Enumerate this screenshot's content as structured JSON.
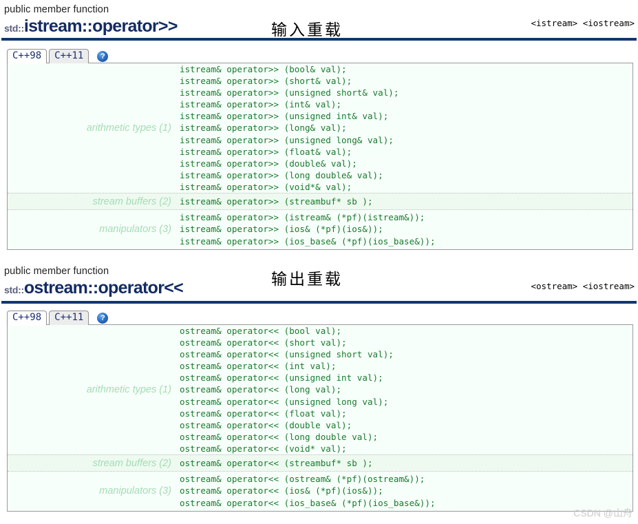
{
  "watermark": "CSDN @山舟",
  "sections": [
    {
      "kind": "public member function",
      "namespace": "std::",
      "name": "istream::operator>>",
      "annotation": "输入重载",
      "headers": [
        "<istream>",
        "<iostream>"
      ],
      "tabs": [
        {
          "label": "C++98",
          "active": true
        },
        {
          "label": "C++11",
          "active": false
        }
      ],
      "help_label": "?",
      "groups": [
        {
          "label": "arithmetic types (1)",
          "highlight": false,
          "code": "istream& operator>> (bool& val);\nistream& operator>> (short& val);\nistream& operator>> (unsigned short& val);\nistream& operator>> (int& val);\nistream& operator>> (unsigned int& val);\nistream& operator>> (long& val);\nistream& operator>> (unsigned long& val);\nistream& operator>> (float& val);\nistream& operator>> (double& val);\nistream& operator>> (long double& val);\nistream& operator>> (void*& val);"
        },
        {
          "label": "stream buffers (2)",
          "highlight": true,
          "code": "istream& operator>> (streambuf* sb );"
        },
        {
          "label": "manipulators (3)",
          "highlight": false,
          "code": "istream& operator>> (istream& (*pf)(istream&));\nistream& operator>> (ios& (*pf)(ios&));\nistream& operator>> (ios_base& (*pf)(ios_base&));"
        }
      ]
    },
    {
      "kind": "public member function",
      "namespace": "std::",
      "name": "ostream::operator<<",
      "annotation": "输出重载",
      "headers": [
        "<ostream>",
        "<iostream>"
      ],
      "tabs": [
        {
          "label": "C++98",
          "active": true
        },
        {
          "label": "C++11",
          "active": false
        }
      ],
      "help_label": "?",
      "groups": [
        {
          "label": "arithmetic types (1)",
          "highlight": false,
          "code": "ostream& operator<< (bool val);\nostream& operator<< (short val);\nostream& operator<< (unsigned short val);\nostream& operator<< (int val);\nostream& operator<< (unsigned int val);\nostream& operator<< (long val);\nostream& operator<< (unsigned long val);\nostream& operator<< (float val);\nostream& operator<< (double val);\nostream& operator<< (long double val);\nostream& operator<< (void* val);"
        },
        {
          "label": "stream buffers (2)",
          "highlight": true,
          "code": "ostream& operator<< (streambuf* sb );"
        },
        {
          "label": "manipulators (3)",
          "highlight": false,
          "code": "ostream& operator<< (ostream& (*pf)(ostream&));\nostream& operator<< (ios& (*pf)(ios&));\nostream& operator<< (ios_base& (*pf)(ios_base&));"
        }
      ]
    }
  ]
}
